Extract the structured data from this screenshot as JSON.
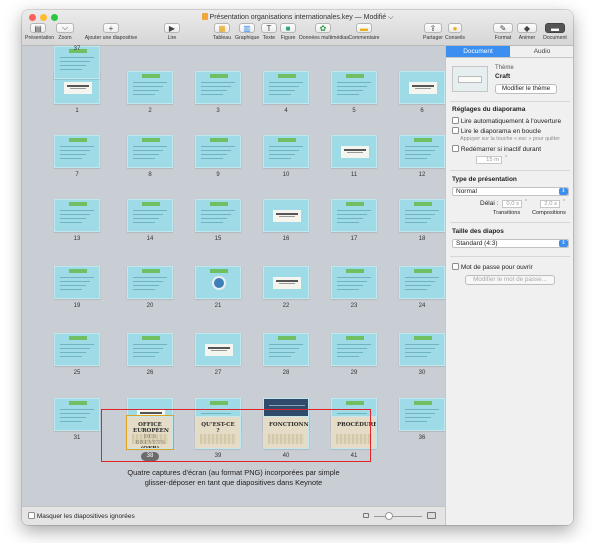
{
  "window": {
    "title": "Présentation organisations internationales.key — Modifié",
    "title_chevron": "⌵"
  },
  "toolbar": {
    "presentation": "Présentation",
    "zoom": "Zoom",
    "add_slide": "Ajouter une diapositive",
    "play": "Lire",
    "table": "Tableau",
    "chart": "Graphique",
    "text": "Texte",
    "shape": "Figure",
    "media": "Données multimédias",
    "comment": "Commentaire",
    "share": "Partager",
    "tips": "Conseils",
    "format": "Format",
    "animate": "Animer",
    "document": "Document"
  },
  "slides": [
    {
      "n": "1",
      "kind": "title"
    },
    {
      "n": "2",
      "kind": "text"
    },
    {
      "n": "3",
      "kind": "text"
    },
    {
      "n": "4",
      "kind": "text"
    },
    {
      "n": "5",
      "kind": "text"
    },
    {
      "n": "6",
      "kind": "title"
    },
    {
      "n": "7",
      "kind": "text"
    },
    {
      "n": "8",
      "kind": "text"
    },
    {
      "n": "9",
      "kind": "text"
    },
    {
      "n": "10",
      "kind": "text"
    },
    {
      "n": "11",
      "kind": "title"
    },
    {
      "n": "12",
      "kind": "text"
    },
    {
      "n": "13",
      "kind": "text"
    },
    {
      "n": "14",
      "kind": "text"
    },
    {
      "n": "15",
      "kind": "text"
    },
    {
      "n": "16",
      "kind": "title"
    },
    {
      "n": "17",
      "kind": "text"
    },
    {
      "n": "18",
      "kind": "text"
    },
    {
      "n": "19",
      "kind": "text"
    },
    {
      "n": "20",
      "kind": "text"
    },
    {
      "n": "21",
      "kind": "globe"
    },
    {
      "n": "22",
      "kind": "title"
    },
    {
      "n": "23",
      "kind": "text"
    },
    {
      "n": "24",
      "kind": "text"
    },
    {
      "n": "25",
      "kind": "text"
    },
    {
      "n": "26",
      "kind": "text"
    },
    {
      "n": "27",
      "kind": "title"
    },
    {
      "n": "28",
      "kind": "text"
    },
    {
      "n": "29",
      "kind": "text"
    },
    {
      "n": "30",
      "kind": "text"
    },
    {
      "n": "31",
      "kind": "text"
    },
    {
      "n": "32",
      "kind": "title"
    },
    {
      "n": "33",
      "kind": "text"
    },
    {
      "n": "34",
      "kind": "dark"
    },
    {
      "n": "35",
      "kind": "text"
    },
    {
      "n": "36",
      "kind": "text"
    },
    {
      "n": "37",
      "kind": "text"
    }
  ],
  "photo_slides": [
    {
      "n": "38",
      "label": "OFFICE EUROPÉEN DES BREVETS (OEB)",
      "selected": true
    },
    {
      "n": "39",
      "label": "QU'EST-CE ?",
      "selected": false
    },
    {
      "n": "40",
      "label": "FONCTIONNEMENT",
      "selected": false
    },
    {
      "n": "41",
      "label": "PROCÉDURE",
      "selected": false
    }
  ],
  "caption": {
    "line1": "Quatre captures d'écran (au format PNG) incorporées par simple",
    "line2": "glisser-déposer en tant que diapositives dans Keynote"
  },
  "bottom": {
    "hide_skipped": "Masquer les diapositives ignorées"
  },
  "inspector": {
    "tab_document": "Document",
    "tab_audio": "Audio",
    "theme_label": "Thème",
    "theme_name": "Craft",
    "change_theme": "Modifier le thème",
    "slideshow_settings": "Réglages du diaporama",
    "autoplay": "Lire automatiquement à l'ouverture",
    "loop": "Lire le diaporama en boucle",
    "loop_hint": "Appuyer sur la touche « esc » pour quitter",
    "restart": "Redémarrer si inactif durant",
    "restart_value": "15 m",
    "presentation_type": "Type de présentation",
    "type_value": "Normal",
    "delay_label": "Délai :",
    "transitions_value": "0,0 s",
    "builds_value": "2,0 s",
    "transitions": "Transitions",
    "builds": "Compositions",
    "slide_size": "Taille des diapos",
    "size_value": "Standard (4:3)",
    "password": "Mot de passe pour ouvrir",
    "change_password": "Modifier le mot de passe..."
  },
  "colors": {
    "accent": "#3b8ff0",
    "slide_bg": "#9fdbe6",
    "slide_bar": "#6fbf63",
    "highlight_box": "#e0242a"
  }
}
